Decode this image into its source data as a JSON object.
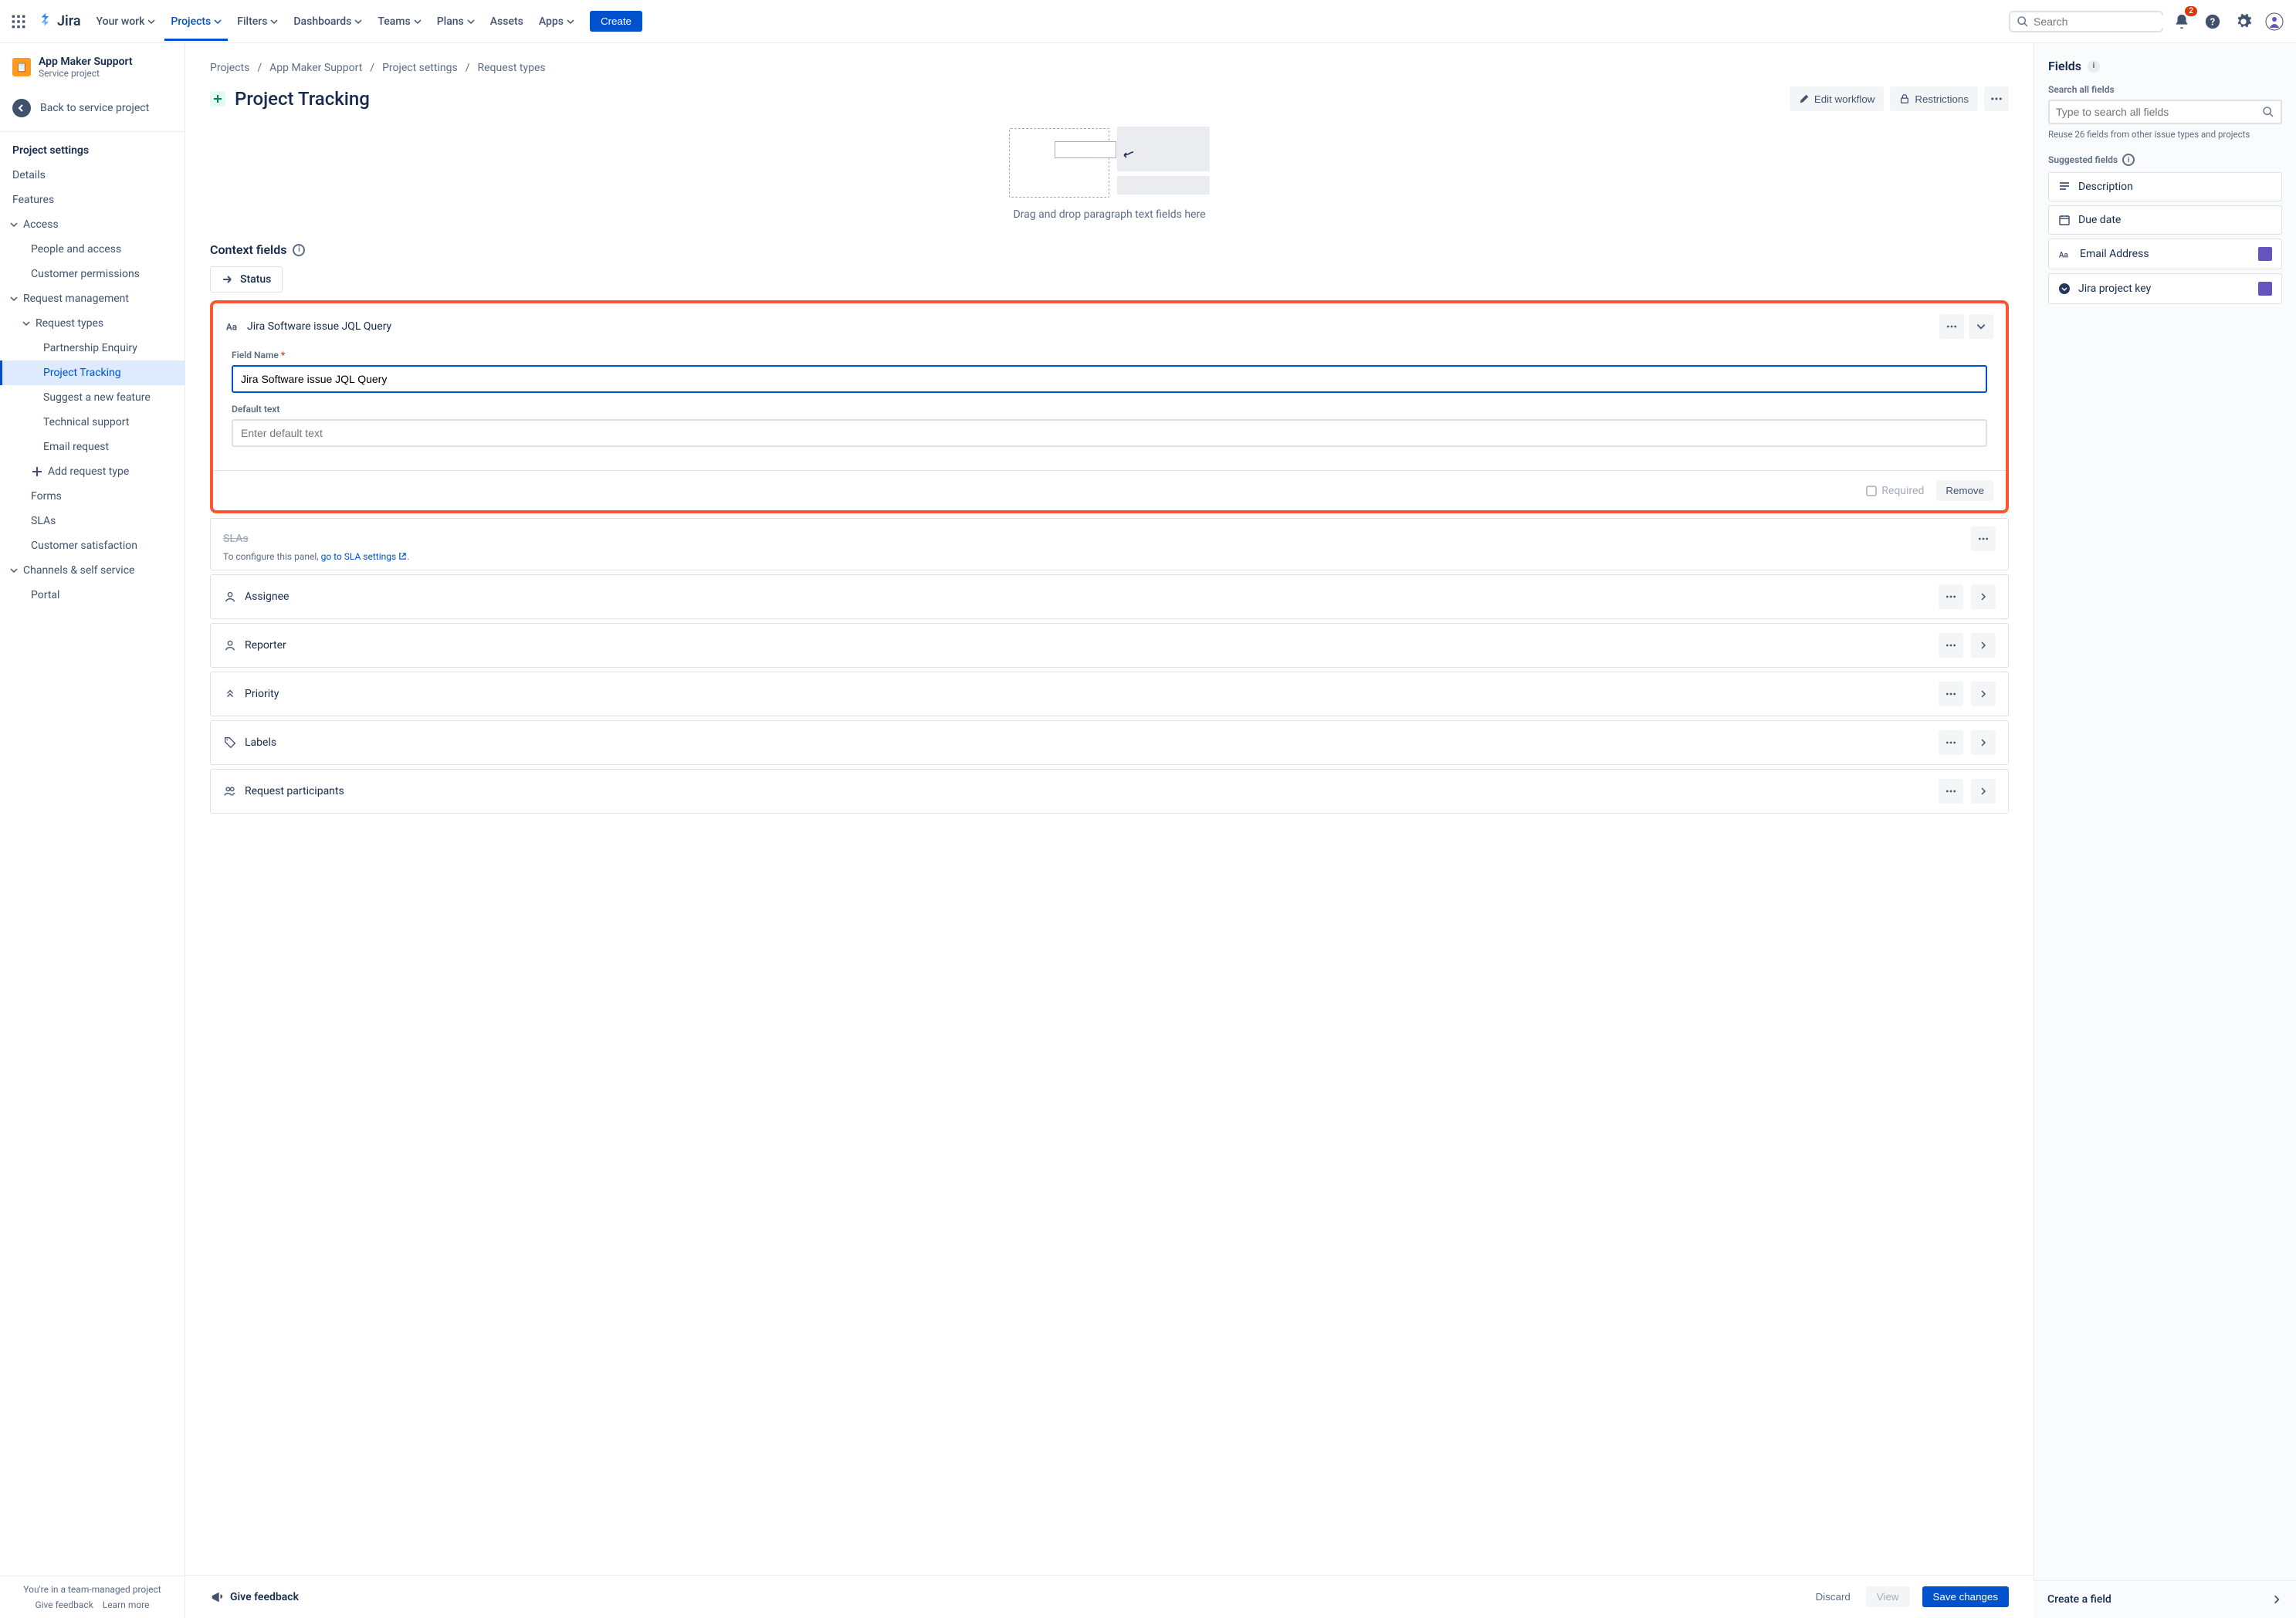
{
  "topbar": {
    "logo": "Jira",
    "nav": [
      "Your work",
      "Projects",
      "Filters",
      "Dashboards",
      "Teams",
      "Plans",
      "Assets",
      "Apps"
    ],
    "create": "Create",
    "search_placeholder": "Search",
    "notif_count": "2"
  },
  "sidebar": {
    "project_name": "App Maker Support",
    "project_type": "Service project",
    "back": "Back to service project",
    "settings_title": "Project settings",
    "details": "Details",
    "features": "Features",
    "access": "Access",
    "people_access": "People and access",
    "customer_permissions": "Customer permissions",
    "request_management": "Request management",
    "request_types": "Request types",
    "rt_partnership": "Partnership Enquiry",
    "rt_project_tracking": "Project Tracking",
    "rt_suggest": "Suggest a new feature",
    "rt_technical": "Technical support",
    "rt_email": "Email request",
    "add_request_type": "Add request type",
    "forms": "Forms",
    "slas": "SLAs",
    "customer_satisfaction": "Customer satisfaction",
    "channels": "Channels & self service",
    "portal": "Portal",
    "footer_text": "You're in a team-managed project",
    "give_feedback": "Give feedback",
    "learn_more": "Learn more"
  },
  "breadcrumb": {
    "a": "Projects",
    "b": "App Maker Support",
    "c": "Project settings",
    "d": "Request types"
  },
  "page": {
    "title": "Project Tracking",
    "edit_workflow": "Edit workflow",
    "restrictions": "Restrictions",
    "dropzone_text": "Drag and drop paragraph text fields here",
    "context_title": "Context fields",
    "status": "Status",
    "field_card": {
      "name": "Jira Software issue JQL Query",
      "field_name_label": "Field Name",
      "field_name_value": "Jira Software issue JQL Query",
      "default_text_label": "Default text",
      "default_text_placeholder": "Enter default text",
      "required": "Required",
      "remove": "Remove"
    },
    "sla_title": "SLAs",
    "sla_hint_a": "To configure this panel, ",
    "sla_hint_b": "go to SLA settings",
    "rows": [
      "Assignee",
      "Reporter",
      "Priority",
      "Labels",
      "Request participants"
    ]
  },
  "bottom": {
    "feedback": "Give feedback",
    "discard": "Discard",
    "view": "View",
    "save": "Save changes"
  },
  "right": {
    "title": "Fields",
    "search_label": "Search all fields",
    "search_placeholder": "Type to search all fields",
    "reuse_hint": "Reuse 26 fields from other issue types and projects",
    "suggested": "Suggested fields",
    "items": [
      "Description",
      "Due date",
      "Email Address",
      "Jira project key"
    ],
    "create": "Create a field"
  }
}
